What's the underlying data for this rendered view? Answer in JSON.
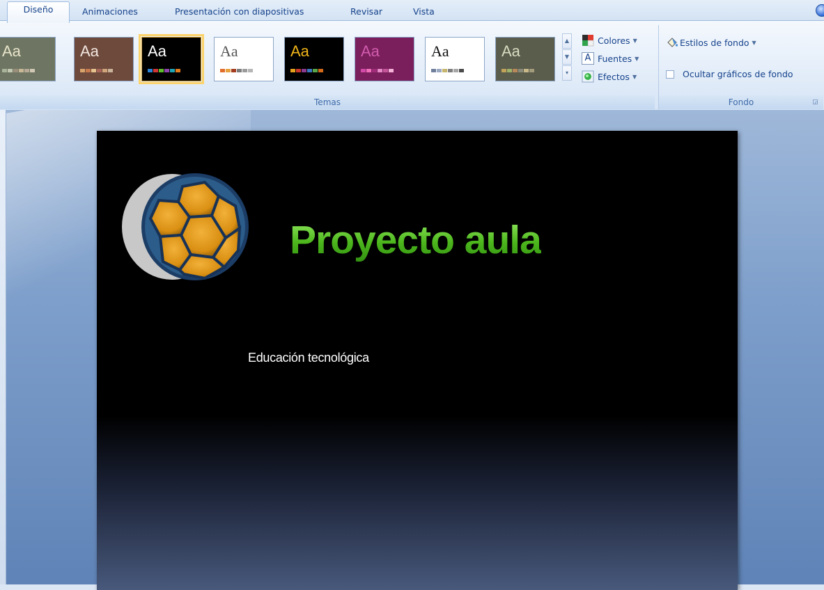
{
  "tabs": [
    {
      "label": "Diseño",
      "active": true
    },
    {
      "label": "Animaciones",
      "active": false
    },
    {
      "label": "Presentación con diapositivas",
      "active": false
    },
    {
      "label": "Revisar",
      "active": false
    },
    {
      "label": "Vista",
      "active": false
    }
  ],
  "ribbon": {
    "temas": {
      "label": "Temas",
      "themes": [
        {
          "name": "theme-1",
          "glyph": "Aa",
          "bg": "#6e7663",
          "text": "#e9e4c9",
          "swatches": [
            "#a9b39a",
            "#c1c7b0",
            "#9a8f7b",
            "#c8b897",
            "#b6a995",
            "#d0c8b4"
          ]
        },
        {
          "name": "theme-2",
          "glyph": "Aa",
          "bg": "#6e4a3d",
          "text": "#f2e7df",
          "swatches": [
            "#d8a46c",
            "#c77a4c",
            "#e6c38e",
            "#a8655a",
            "#cfa57b",
            "#c9b39a"
          ]
        },
        {
          "name": "theme-3",
          "glyph": "Aa",
          "bg": "#000000",
          "text": "#ffffff",
          "swatches": [
            "#2c84d4",
            "#d03535",
            "#5dbb2c",
            "#8e44ad",
            "#1fa4b6",
            "#e07b1f"
          ]
        },
        {
          "name": "theme-4",
          "glyph": "Aa",
          "bg": "#ffffff",
          "text": "#555555",
          "swatches": [
            "#e06d2a",
            "#e6a03c",
            "#a33b1e",
            "#7b7b7b",
            "#9b9b9b",
            "#b5b5b5"
          ]
        },
        {
          "name": "theme-5",
          "glyph": "Aa",
          "bg": "#000000",
          "text": "#f2b61b",
          "swatches": [
            "#e6a11c",
            "#c9382b",
            "#8a3b8f",
            "#3a78c2",
            "#5aa64a",
            "#d46b1a"
          ]
        },
        {
          "name": "theme-6",
          "glyph": "Aa",
          "bg": "#7a1f5c",
          "text": "#d15cae",
          "swatches": [
            "#d34aa8",
            "#f06fb8",
            "#a12d7a",
            "#e78ac7",
            "#c45599",
            "#f7b2d9"
          ]
        },
        {
          "name": "theme-7",
          "glyph": "Aa",
          "bg": "#ffffff",
          "text": "#111111",
          "swatches": [
            "#6f7f9c",
            "#9aa7c0",
            "#c6b56c",
            "#7e7e7e",
            "#a6a6a6",
            "#4a4a4a"
          ]
        },
        {
          "name": "theme-8",
          "glyph": "Aa",
          "bg": "#5a5c4c",
          "text": "#d8dcc0",
          "swatches": [
            "#c2a35a",
            "#9fb26a",
            "#b8885a",
            "#8a8a7a",
            "#c9b98a",
            "#a39c7c"
          ]
        }
      ],
      "selected_index": 2,
      "side": {
        "colores": "Colores",
        "fuentes": "Fuentes",
        "efectos": "Efectos",
        "fuentes_icon_glyph": "A"
      }
    },
    "fondo": {
      "label": "Fondo",
      "estilos": "Estilos de fondo",
      "ocultar": "Ocultar gráficos de fondo",
      "ocultar_checked": false
    }
  },
  "slide": {
    "title": "Proyecto aula",
    "subtitle": "Educación tecnológica"
  },
  "colors": {
    "title_green": "#5cc42a",
    "ball_orange": "#e89a18",
    "ball_navy": "#1c3d66"
  }
}
